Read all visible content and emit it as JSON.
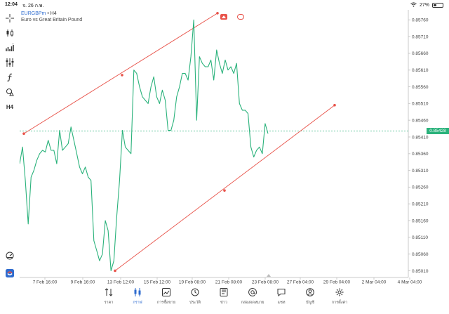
{
  "status_bar": {
    "time": "12:04",
    "date": "จ. 26 ก.พ.",
    "battery": "27%",
    "battery_level": 0.27
  },
  "chart": {
    "symbol": "EURGBPm",
    "timeframe": "H4",
    "separator": " • ",
    "description": "Euro vs Great Britain Pound",
    "current_price": "0.85428",
    "colors": {
      "line": "#2ab27b",
      "channel": "#e8534a",
      "current_price": "#2ab27b",
      "accent": "#2f6ccf"
    },
    "price_labels": [
      "0.85760",
      "0.85710",
      "0.85660",
      "0.85610",
      "0.85560",
      "0.85510",
      "0.85460",
      "0.85410",
      "0.85360",
      "0.85310",
      "0.85260",
      "0.85210",
      "0.85160",
      "0.85110",
      "0.85060",
      "0.85010"
    ],
    "time_labels": [
      "7 Feb 16:00",
      "9 Feb 16:00",
      "13 Feb 12:00",
      "15 Feb 12:00",
      "19 Feb 08:00",
      "21 Feb 08:00",
      "23 Feb 08:00",
      "27 Feb 04:00",
      "29 Feb 04:00",
      "2 Mar 04:00",
      "4 Mar 04:00"
    ]
  },
  "chart_data": {
    "type": "line",
    "title": "EURGBPm • H4",
    "ylim": [
      0.8499,
      0.8579
    ],
    "x": [
      0,
      1,
      2,
      3,
      4,
      5,
      6,
      7,
      8,
      9,
      10,
      11,
      12,
      13,
      14,
      15,
      16,
      17,
      18,
      19,
      20,
      21,
      22,
      23,
      24,
      25,
      26,
      27,
      28,
      29,
      30,
      31,
      32,
      33,
      34,
      35,
      36,
      37,
      38,
      39,
      40,
      41,
      42,
      43,
      44,
      45,
      46,
      47,
      48,
      49,
      50,
      51,
      52,
      53,
      54,
      55,
      56,
      57,
      58,
      59,
      60,
      61,
      62,
      63,
      64,
      65,
      66,
      67,
      68,
      69,
      70,
      71,
      72,
      73,
      74,
      75,
      76,
      77,
      78,
      79,
      80,
      81,
      82,
      83,
      84,
      85,
      86,
      87,
      88,
      89,
      90,
      91,
      92,
      93,
      94,
      95,
      96,
      97,
      98,
      99,
      100
    ],
    "series": [
      {
        "name": "EURGBPm",
        "values": [
          0.8533,
          0.8538,
          0.8528,
          0.8515,
          0.8529,
          0.8531,
          0.8534,
          0.8536,
          0.8537,
          0.85365,
          0.854,
          0.8537,
          0.8537,
          0.8533,
          0.8543,
          0.8537,
          0.8538,
          0.8539,
          0.8544,
          0.854,
          0.8536,
          0.8532,
          0.853,
          0.8532,
          0.8529,
          0.8528,
          0.851,
          0.8507,
          0.8504,
          0.8506,
          0.8516,
          0.8513,
          0.8501,
          0.8504,
          0.8517,
          0.8528,
          0.8543,
          0.8538,
          0.8537,
          0.8536,
          0.8561,
          0.856,
          0.8556,
          0.8553,
          0.8552,
          0.8551,
          0.8556,
          0.8559,
          0.8553,
          0.8551,
          0.8555,
          0.8552,
          0.8543,
          0.8543,
          0.8546,
          0.8553,
          0.8556,
          0.856,
          0.856,
          0.8558,
          0.8565,
          0.8576,
          0.8546,
          0.8565,
          0.8563,
          0.8562,
          0.8562,
          0.8564,
          0.8558,
          0.8567,
          0.8563,
          0.856,
          0.8564,
          0.8561,
          0.8562,
          0.856,
          0.8563,
          0.8551,
          0.8549,
          0.8549,
          0.8548,
          0.8538,
          0.8535,
          0.8537,
          0.8538,
          0.8536,
          0.8545,
          0.8542
        ]
      }
    ]
  },
  "left_toolbar": [
    {
      "icon": "crosshair-icon"
    },
    {
      "icon": "candles-icon"
    },
    {
      "icon": "indicators-icon"
    },
    {
      "icon": "settings-sliders-icon"
    },
    {
      "icon": "function-icon"
    },
    {
      "icon": "shapes-icon"
    },
    {
      "icon": "timeframe-icon",
      "label": "H4"
    },
    {
      "icon": "speedometer-icon"
    },
    {
      "icon": "app-logo-icon"
    }
  ],
  "bottom_nav": [
    {
      "label": "ราคา",
      "icon": "quotes-icon",
      "active": false
    },
    {
      "label": "กราฟ",
      "icon": "chart-icon",
      "active": true
    },
    {
      "label": "การซื้อขาย",
      "icon": "trade-icon",
      "active": false
    },
    {
      "label": "ประวัติ",
      "icon": "history-icon",
      "active": false
    },
    {
      "label": "ข่าว",
      "icon": "news-icon",
      "active": false
    },
    {
      "label": "กล่องจดหมาย",
      "icon": "mailbox-icon",
      "active": false
    },
    {
      "label": "แชท",
      "icon": "chat-icon",
      "active": false
    },
    {
      "label": "บัญชี",
      "icon": "account-icon",
      "active": false
    },
    {
      "label": "การตั้งค่า",
      "icon": "settings-icon",
      "active": false
    }
  ]
}
